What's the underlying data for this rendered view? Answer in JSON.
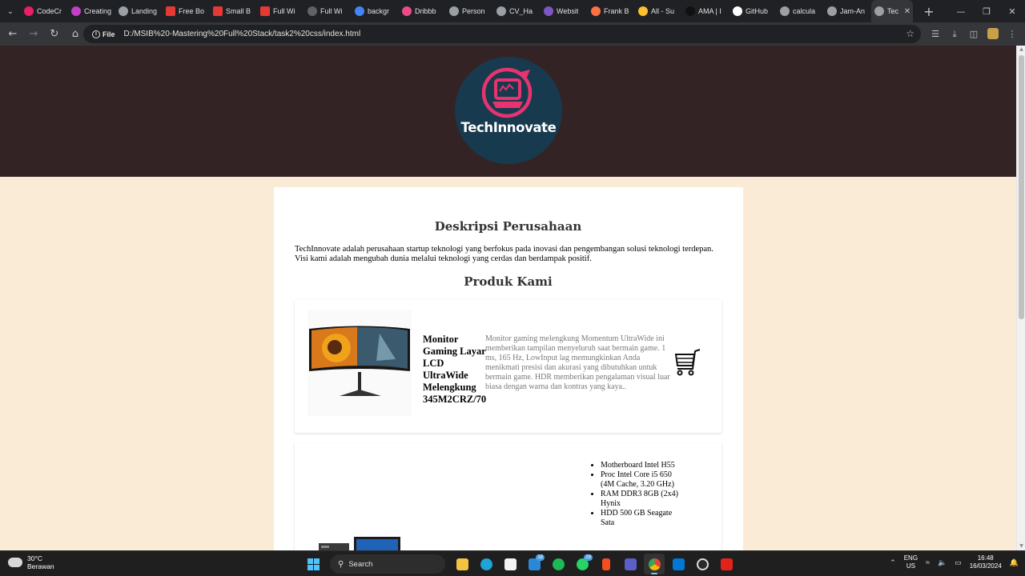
{
  "browser": {
    "tabs": [
      {
        "title": "CodeCr",
        "icon": "codecrafters-icon",
        "color": "#e91e63"
      },
      {
        "title": "Creating",
        "icon": "creating-icon",
        "color": "#c43fc4"
      },
      {
        "title": "Landing",
        "icon": "globe-icon",
        "color": "#9aa0a6"
      },
      {
        "title": "Free Bo",
        "icon": "s-icon",
        "color": "#e53935"
      },
      {
        "title": "Small B",
        "icon": "s-icon",
        "color": "#e53935"
      },
      {
        "title": "Full Wi",
        "icon": "s-icon",
        "color": "#e53935"
      },
      {
        "title": "Full Wi",
        "icon": "globe-dark-icon",
        "color": "#5f6368"
      },
      {
        "title": "backgr",
        "icon": "google-icon",
        "color": "#4285f4"
      },
      {
        "title": "Dribbb",
        "icon": "dribbble-icon",
        "color": "#ea4c89"
      },
      {
        "title": "Person",
        "icon": "globe-icon",
        "color": "#9aa0a6"
      },
      {
        "title": "CV_Ha",
        "icon": "globe-icon",
        "color": "#9aa0a6"
      },
      {
        "title": "Websit",
        "icon": "website-icon",
        "color": "#7e57c2"
      },
      {
        "title": "Frank B",
        "icon": "frank-icon",
        "color": "#ff7043"
      },
      {
        "title": "All - Su",
        "icon": "yellow-dot-icon",
        "color": "#fbc02d"
      },
      {
        "title": "AMA | I",
        "icon": "ama-icon",
        "color": "#111111"
      },
      {
        "title": "GitHub",
        "icon": "github-icon",
        "color": "#ffffff"
      },
      {
        "title": "calcula",
        "icon": "globe-icon",
        "color": "#9aa0a6"
      },
      {
        "title": "Jam-An",
        "icon": "globe-icon",
        "color": "#9aa0a6"
      },
      {
        "title": "Tec",
        "icon": "globe-icon",
        "color": "#9aa0a6",
        "active": true
      }
    ],
    "omnibox_chip": "File",
    "url": "D:/MSIB%20-Mastering%20Full%20Stack/task2%20css/index.html"
  },
  "site": {
    "brand": "TechInnovate",
    "colors": {
      "header_bg": "#342325",
      "page_bg": "#faebd7",
      "logo_bg": "#173a4f",
      "logo_accent": "#e8336f"
    },
    "description_heading": "Deskripsi Perusahaan",
    "description_text": "TechInnovate adalah perusahaan startup teknologi yang berfokus pada inovasi dan pengembangan solusi teknologi terdepan. Visi kami adalah mengubah dunia melalui teknologi yang cerdas dan berdampak positif.",
    "products_heading": "Produk Kami",
    "products": [
      {
        "name": "Monitor Gaming Layar LCD UltraWide Melengkung 345M2CRZ/70",
        "detail": "Monitor gaming melengkung Momentum UltraWide ini memberikan tampilan menyeluruh saat bermain game. 1 ms, 165 Hz, LowInput lag memungkinkan Anda menikmati presisi dan akurasi yang dibutuhkan untuk bermain game. HDR memberikan pengalaman visual luar biasa dengan warna dan kontras yang kaya..",
        "action_icon": "shopping-cart-icon"
      },
      {
        "specs": [
          "Motherboard Intel H55",
          "Proc Intel Core i5 650 (4M Cache, 3.20 GHz)",
          "RAM DDR3 8GB (2x4) Hynix",
          "HDD 500 GB Seagate Sata"
        ]
      }
    ]
  },
  "taskbar": {
    "weather_temp": "30°C",
    "weather_desc": "Berawan",
    "search_label": "Search",
    "lang_top": "ENG",
    "lang_bottom": "US",
    "time": "16:48",
    "date": "16/03/2024",
    "badges": {
      "mail": "18",
      "whatsapp": "29"
    }
  }
}
